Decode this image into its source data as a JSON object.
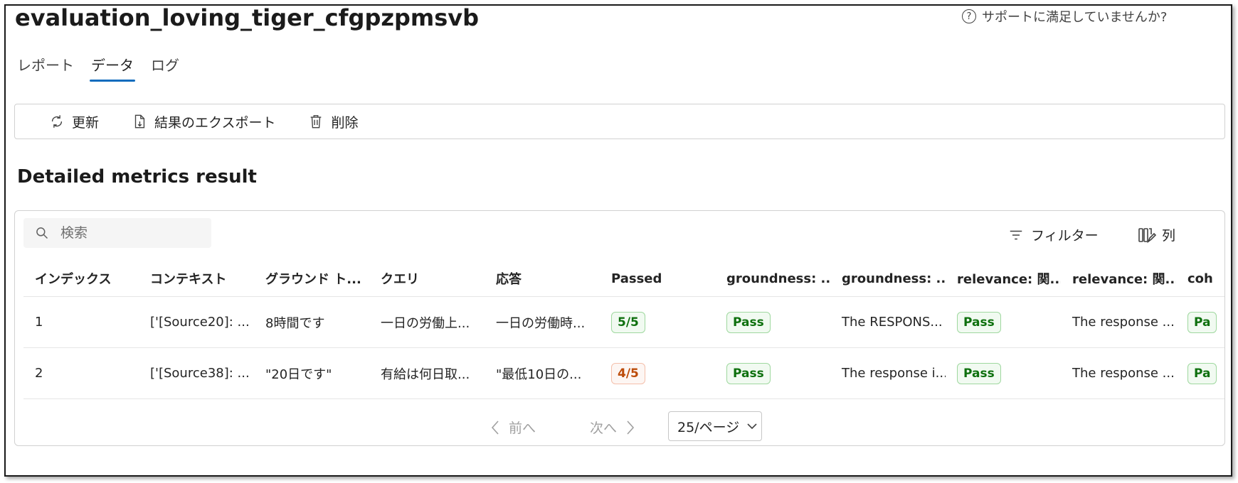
{
  "header": {
    "title": "evaluation_loving_tiger_cfgpzpmsvb",
    "support_text": "サポートに満足していませんか?"
  },
  "tabs": [
    {
      "label": "レポート",
      "active": false
    },
    {
      "label": "データ",
      "active": true
    },
    {
      "label": "ログ",
      "active": false
    }
  ],
  "toolbar": {
    "refresh_label": "更新",
    "export_label": "結果のエクスポート",
    "delete_label": "削除"
  },
  "section_title": "Detailed metrics result",
  "search": {
    "placeholder": "検索",
    "value": ""
  },
  "filter_label": "フィルター",
  "columns_label": "列",
  "table": {
    "columns": [
      "インデックス",
      "コンテキスト",
      "グラウンド ト...",
      "クエリ",
      "応答",
      "Passed",
      "groundness: ...",
      "groundness: ...",
      "relevance: 関...",
      "relevance: 関...",
      "coh"
    ],
    "rows": [
      {
        "index": "1",
        "context": "['[Source20]: ...",
        "ground_truth": "8時間です",
        "query": "一日の労働上...",
        "response": "一日の労働時...",
        "passed": "5/5",
        "groundness_result": "Pass",
        "groundness_reason": "The RESPONS...",
        "relevance_result": "Pass",
        "relevance_reason": "The response ...",
        "coherence_result": "Pa"
      },
      {
        "index": "2",
        "context": "['[Source38]: ...",
        "ground_truth": "\"20日です\"",
        "query": "有給は何日取...",
        "response": "\"最低10日の...",
        "passed": "4/5",
        "groundness_result": "Pass",
        "groundness_reason": "The response i...",
        "relevance_result": "Pass",
        "relevance_reason": "The response ...",
        "coherence_result": "Pa"
      }
    ]
  },
  "pagination": {
    "prev_label": "前へ",
    "next_label": "次へ",
    "page_size": "25/ページ"
  },
  "colors": {
    "accent": "#0f6cbd",
    "pass_text": "#0e700e",
    "warn_text": "#bc4b09"
  }
}
